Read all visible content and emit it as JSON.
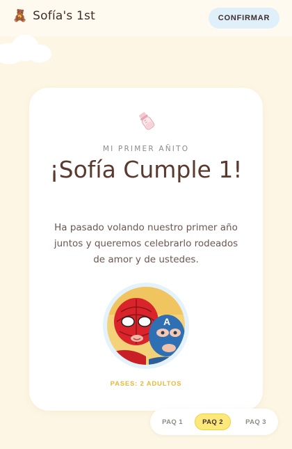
{
  "header": {
    "brand_icon": "teddy-bear-icon",
    "brand_title": "Sofía's 1st",
    "confirm_label": "CONFIRMAR"
  },
  "card": {
    "icon": "baby-bottle-icon",
    "eyebrow": "MI PRIMER AÑITO",
    "title": "¡Sofía Cumple 1!",
    "body": "Ha pasado volando nuestro primer año juntos y queremos celebrarlo rodeados de amor y de ustedes.",
    "photo": "kids-superhero-masks-photo",
    "passes": "PASES: 2 ADULTOS"
  },
  "pager": {
    "tabs": [
      {
        "label": "PAQ 1",
        "active": false
      },
      {
        "label": "PAQ 2",
        "active": true
      },
      {
        "label": "PAQ 3",
        "active": false
      }
    ]
  },
  "colors": {
    "page_bg": "#fdf6e4",
    "confirm_bg": "#dff0fb",
    "title": "#5a3a2e",
    "accent_yellow": "#e8b83a",
    "active_tab": "#fde97a"
  }
}
